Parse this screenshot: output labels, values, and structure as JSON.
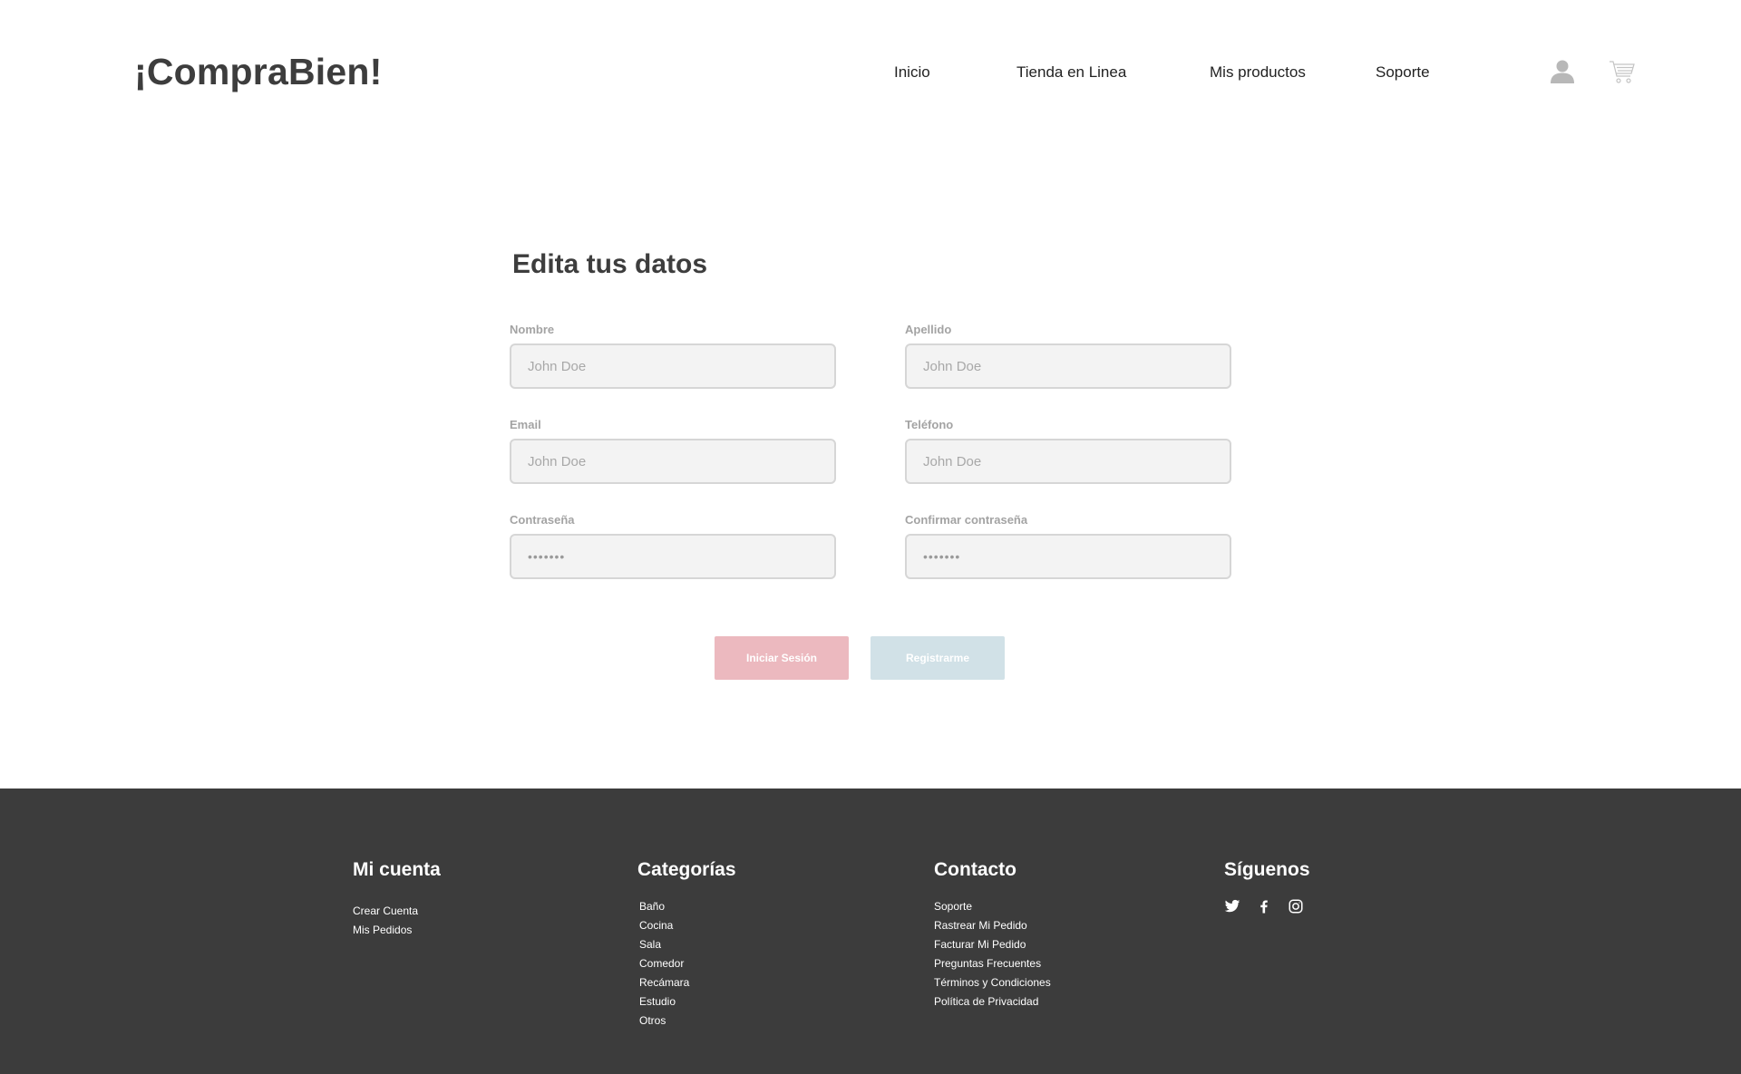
{
  "header": {
    "logo": "¡CompraBien!",
    "nav": {
      "inicio": "Inicio",
      "tienda": "Tienda en Linea",
      "productos": "Mis productos",
      "soporte": "Soporte"
    },
    "icons": [
      "user-icon",
      "cart-icon"
    ]
  },
  "form": {
    "title": "Edita tus datos",
    "fields": {
      "nombre": {
        "label": "Nombre",
        "placeholder": "John Doe"
      },
      "apellido": {
        "label": "Apellido",
        "placeholder": "John Doe"
      },
      "email": {
        "label": "Email",
        "placeholder": "John Doe"
      },
      "telefono": {
        "label": "Teléfono",
        "placeholder": "John Doe"
      },
      "contrasena": {
        "label": "Contraseña",
        "value": "•••••••"
      },
      "confirmar": {
        "label": "Confirmar contraseña",
        "value": "•••••••"
      }
    },
    "buttons": {
      "login": "Iniciar Sesión",
      "register": "Registrarme"
    },
    "colors": {
      "login_button": "#ecb9bf",
      "register_button": "#d1e1e7",
      "input_background": "#f3f3f3"
    }
  },
  "footer": {
    "background": "#3c3c3c",
    "cuenta": {
      "heading": "Mi cuenta",
      "links": [
        "Crear Cuenta",
        "Mis Pedidos"
      ]
    },
    "categorias": {
      "heading": "Categorías",
      "links": [
        "Baño",
        "Cocina",
        "Sala",
        "Comedor",
        "Recámara",
        "Estudio",
        "Otros"
      ]
    },
    "contacto": {
      "heading": "Contacto",
      "links": [
        "Soporte",
        "Rastrear Mi Pedido",
        "Facturar Mi Pedido",
        "Preguntas Frecuentes",
        "Términos y Condiciones",
        "Política de Privacidad"
      ]
    },
    "siguenos": {
      "heading": "Síguenos",
      "icons": [
        "twitter-icon",
        "facebook-icon",
        "instagram-icon"
      ]
    }
  }
}
